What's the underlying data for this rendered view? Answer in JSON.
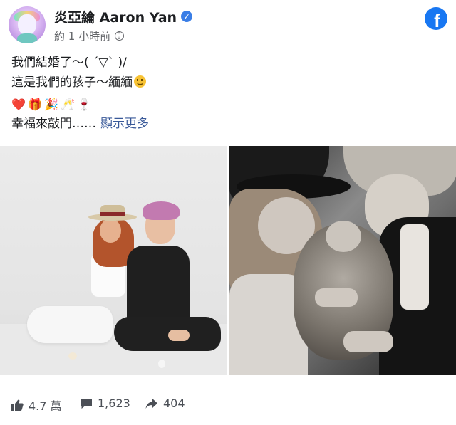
{
  "author": {
    "name": "炎亞綸 Aaron Yan",
    "timestamp": "約 1 小時前"
  },
  "post": {
    "lines": [
      "我們結婚了～( ´▽` )/",
      "這是我們的孩子～緬緬"
    ],
    "emojis": [
      "❤️",
      "🎁",
      "🎉",
      "🥂",
      "🍷"
    ],
    "last_line": "幸福來敲門……",
    "see_more": "顯示更多"
  },
  "stats": {
    "likes": "4.7 萬",
    "comments": "1,623",
    "shares": "404"
  },
  "colors": {
    "facebook_blue": "#1877f2",
    "verified_blue": "#3a7ee6",
    "link": "#385898",
    "meta_grey": "#65676b"
  },
  "icons": {
    "brand": "facebook-logo-icon",
    "verified": "verified-badge-icon",
    "privacy": "globe-icon",
    "like": "thumbs-up-icon",
    "comment": "comment-icon",
    "share": "share-arrow-icon"
  }
}
